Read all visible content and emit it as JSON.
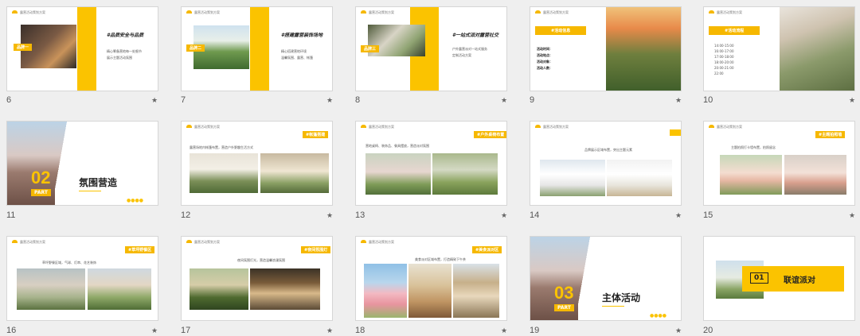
{
  "slides": [
    {
      "num": "6",
      "title": "#品质安全与品质",
      "tag": "品牌一",
      "l1": "精心筹备营地每一处细节",
      "l2": "展示主题活动氛围"
    },
    {
      "num": "7",
      "title": "#搭建露营装饰场地",
      "tag": "品牌二",
      "l1": "精心搭建营地环境",
      "l2": "温馨氛围、露营、帐篷"
    },
    {
      "num": "8",
      "title": "#一站式派对露营社交",
      "tag": "品牌三",
      "l1": "户外露营派对一站式服务",
      "l2": "定制活动方案"
    },
    {
      "num": "9",
      "tag": "#活动信息",
      "rows": [
        "活动时间：",
        "活动地点：",
        "活动对象：",
        "活动人数："
      ]
    },
    {
      "num": "10",
      "tag": "#活动流程",
      "rows": [
        "14:00-15:00",
        "16:00-17:00",
        "17:00-18:00",
        "18:00-20:00",
        "20:00-21:00",
        "22:00"
      ]
    },
    {
      "num": "11",
      "bignum": "02",
      "part": "PART",
      "heading": "氛围营造"
    },
    {
      "num": "12",
      "tag": "#帐篷搭建",
      "text": "露营场地内帐篷布置，营造户外野趣生活方式"
    },
    {
      "num": "13",
      "tag": "#户外桌椅布置",
      "text": "营地桌椅、装饰品、餐具摆放，营造派对氛围"
    },
    {
      "num": "14",
      "tag": "",
      "text": "品牌展示区域布置，突出主题元素"
    },
    {
      "num": "15",
      "tag": "#主题拍照墙",
      "text": "主题拍照打卡墙布置，拍照留念"
    },
    {
      "num": "16",
      "tag": "#草坪野餐区",
      "text": "草坪野餐区域，气球、灯串、花艺装饰"
    },
    {
      "num": "17",
      "tag": "#夜间氛围灯",
      "text": "夜间氛围灯光，营造温馨浪漫氛围"
    },
    {
      "num": "18",
      "tag": "#美食派对区",
      "text": "美食派对区域布置，打造精致下午茶"
    },
    {
      "num": "19",
      "bignum": "03",
      "part": "PART",
      "heading": "主体活动"
    },
    {
      "num": "20",
      "box_num": "01",
      "box_text": "联谊派对"
    }
  ],
  "star_symbol": "★",
  "header_text": "露营活动策划方案"
}
